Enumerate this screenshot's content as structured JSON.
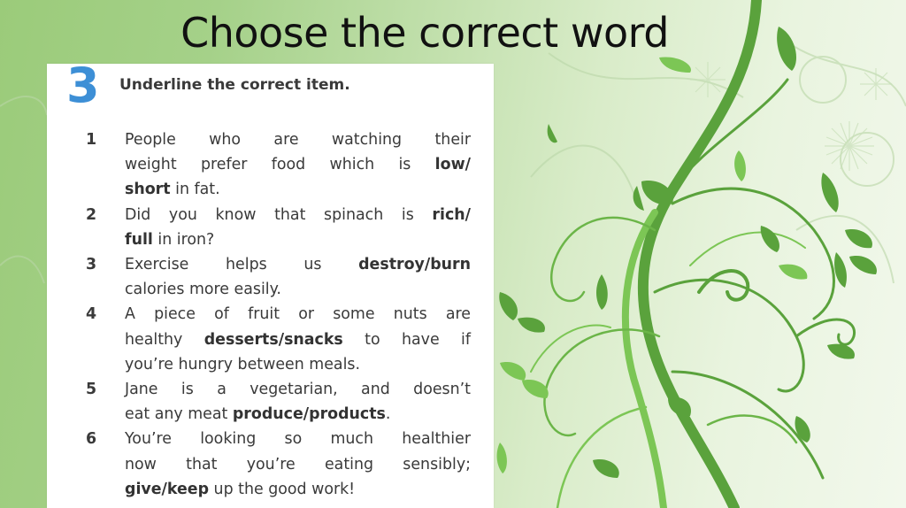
{
  "slide": {
    "title": "Choose the correct word"
  },
  "exercise": {
    "number": "3",
    "instruction": "Underline the correct item.",
    "items": [
      {
        "num": "1",
        "lines": [
          [
            {
              "t": "People who are watching their"
            }
          ],
          [
            {
              "t": "weight prefer food which is "
            },
            {
              "t": "low/",
              "b": true
            }
          ],
          [
            {
              "t": "short",
              "b": true
            },
            {
              "t": " in fat."
            }
          ]
        ]
      },
      {
        "num": "2",
        "lines": [
          [
            {
              "t": "Did you know that spinach is "
            },
            {
              "t": "rich/",
              "b": true
            }
          ],
          [
            {
              "t": "full",
              "b": true
            },
            {
              "t": " in iron?"
            }
          ]
        ]
      },
      {
        "num": "3",
        "lines": [
          [
            {
              "t": "Exercise helps us "
            },
            {
              "t": "destroy/burn",
              "b": true
            }
          ],
          [
            {
              "t": "calories more easily."
            }
          ]
        ]
      },
      {
        "num": "4",
        "lines": [
          [
            {
              "t": "A piece of fruit or some nuts are"
            }
          ],
          [
            {
              "t": "healthy "
            },
            {
              "t": "desserts/snacks",
              "b": true
            },
            {
              "t": " to have if"
            }
          ],
          [
            {
              "t": "you’re hungry between meals."
            }
          ]
        ]
      },
      {
        "num": "5",
        "lines": [
          [
            {
              "t": "Jane is a vegetarian, and doesn’t"
            }
          ],
          [
            {
              "t": "eat any meat "
            },
            {
              "t": "produce/products",
              "b": true
            },
            {
              "t": "."
            }
          ]
        ]
      },
      {
        "num": "6",
        "lines": [
          [
            {
              "t": "You’re looking so much healthier"
            }
          ],
          [
            {
              "t": "now that you’re eating sensibly;"
            }
          ],
          [
            {
              "t": "give/keep",
              "b": true
            },
            {
              "t": " up the good work!"
            }
          ]
        ]
      }
    ]
  },
  "colors": {
    "number_blue": "#3d8fd6",
    "vine_dark": "#5aa23c",
    "vine_light": "#7cc655",
    "text": "#3a3a3a"
  }
}
